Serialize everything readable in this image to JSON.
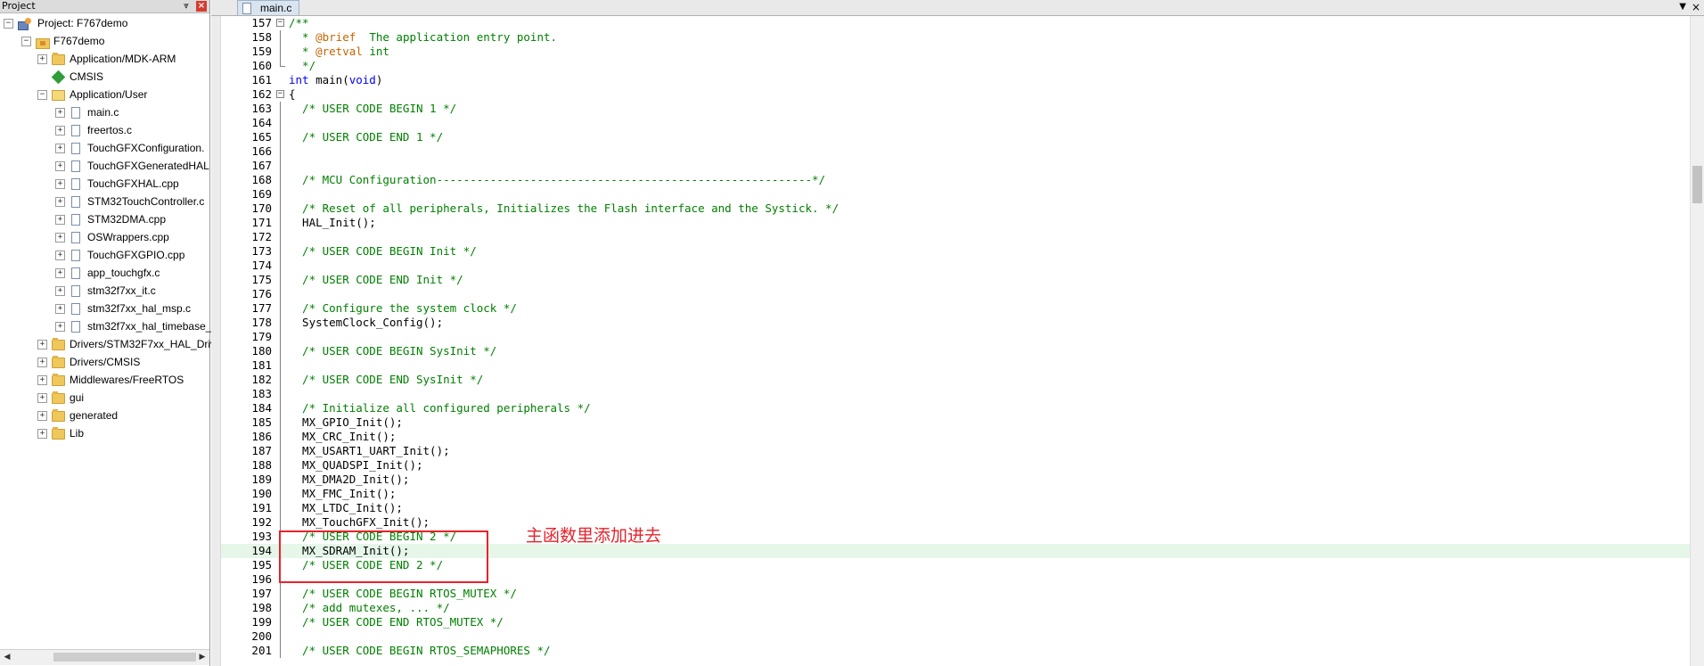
{
  "project_panel": {
    "title": "Project",
    "pin_glyph": "⩔",
    "close_glyph": "×",
    "tree": [
      {
        "label": "Project: F767demo",
        "icon": "project-icon",
        "expander": "−"
      },
      {
        "label": "F767demo",
        "icon": "target-icon",
        "expander": "−"
      },
      {
        "label": "Application/MDK-ARM",
        "icon": "folder-icon",
        "expander": "+"
      },
      {
        "label": "CMSIS",
        "icon": "diamond-icon",
        "expander": ""
      },
      {
        "label": "Application/User",
        "icon": "folder-open-icon",
        "expander": "−"
      },
      {
        "label": "main.c",
        "icon": "file-icon",
        "expander": "+"
      },
      {
        "label": "freertos.c",
        "icon": "file-icon",
        "expander": "+"
      },
      {
        "label": "TouchGFXConfiguration.",
        "icon": "file-icon",
        "expander": "+"
      },
      {
        "label": "TouchGFXGeneratedHAL",
        "icon": "file-icon",
        "expander": "+"
      },
      {
        "label": "TouchGFXHAL.cpp",
        "icon": "file-icon",
        "expander": "+"
      },
      {
        "label": "STM32TouchController.c",
        "icon": "file-icon",
        "expander": "+"
      },
      {
        "label": "STM32DMA.cpp",
        "icon": "file-icon",
        "expander": "+"
      },
      {
        "label": "OSWrappers.cpp",
        "icon": "file-icon",
        "expander": "+"
      },
      {
        "label": "TouchGFXGPIO.cpp",
        "icon": "file-icon",
        "expander": "+"
      },
      {
        "label": "app_touchgfx.c",
        "icon": "file-icon",
        "expander": "+"
      },
      {
        "label": "stm32f7xx_it.c",
        "icon": "file-icon",
        "expander": "+"
      },
      {
        "label": "stm32f7xx_hal_msp.c",
        "icon": "file-icon",
        "expander": "+"
      },
      {
        "label": "stm32f7xx_hal_timebase_",
        "icon": "file-icon",
        "expander": "+"
      },
      {
        "label": "Drivers/STM32F7xx_HAL_Driv",
        "icon": "folder-icon",
        "expander": "+"
      },
      {
        "label": "Drivers/CMSIS",
        "icon": "folder-icon",
        "expander": "+"
      },
      {
        "label": "Middlewares/FreeRTOS",
        "icon": "folder-icon",
        "expander": "+"
      },
      {
        "label": "gui",
        "icon": "folder-icon",
        "expander": "+"
      },
      {
        "label": "generated",
        "icon": "folder-icon",
        "expander": "+"
      },
      {
        "label": "Lib",
        "icon": "folder-icon",
        "expander": "+"
      }
    ],
    "scroll_left_glyph": "◀",
    "scroll_right_glyph": "▶"
  },
  "editor": {
    "tab_label": "main.c",
    "tab_dropdown_glyph": "▼",
    "tab_close_glyph": "×",
    "current_line": 194,
    "colors": {
      "comment": "#008000",
      "keyword": "#0000ff",
      "doc_tag": "#c86400",
      "current_line_bg": "#e6f7e9"
    },
    "lines": [
      {
        "n": "157",
        "text": "/**",
        "kind": "comment",
        "fold": "box"
      },
      {
        "n": "158",
        "text": "  * @brief  The application entry point.",
        "kind": "doc",
        "fold": "line"
      },
      {
        "n": "159",
        "text": "  * @retval int",
        "kind": "doc",
        "fold": "line"
      },
      {
        "n": "160",
        "text": "  */",
        "kind": "comment",
        "fold": "end"
      },
      {
        "n": "161",
        "text": "int main(void)",
        "kind": "signature",
        "fold": ""
      },
      {
        "n": "162",
        "text": "{",
        "kind": "plain",
        "fold": "box"
      },
      {
        "n": "163",
        "text": "  /* USER CODE BEGIN 1 */",
        "kind": "comment",
        "fold": "line"
      },
      {
        "n": "164",
        "text": "",
        "kind": "plain",
        "fold": "line"
      },
      {
        "n": "165",
        "text": "  /* USER CODE END 1 */",
        "kind": "comment",
        "fold": "line"
      },
      {
        "n": "166",
        "text": "",
        "kind": "plain",
        "fold": "line"
      },
      {
        "n": "167",
        "text": "",
        "kind": "plain",
        "fold": "line"
      },
      {
        "n": "168",
        "text": "  /* MCU Configuration--------------------------------------------------------*/",
        "kind": "comment",
        "fold": "line"
      },
      {
        "n": "169",
        "text": "",
        "kind": "plain",
        "fold": "line"
      },
      {
        "n": "170",
        "text": "  /* Reset of all peripherals, Initializes the Flash interface and the Systick. */",
        "kind": "comment",
        "fold": "line"
      },
      {
        "n": "171",
        "text": "  HAL_Init();",
        "kind": "plain",
        "fold": "line"
      },
      {
        "n": "172",
        "text": "",
        "kind": "plain",
        "fold": "line"
      },
      {
        "n": "173",
        "text": "  /* USER CODE BEGIN Init */",
        "kind": "comment",
        "fold": "line"
      },
      {
        "n": "174",
        "text": "",
        "kind": "plain",
        "fold": "line"
      },
      {
        "n": "175",
        "text": "  /* USER CODE END Init */",
        "kind": "comment",
        "fold": "line"
      },
      {
        "n": "176",
        "text": "",
        "kind": "plain",
        "fold": "line"
      },
      {
        "n": "177",
        "text": "  /* Configure the system clock */",
        "kind": "comment",
        "fold": "line"
      },
      {
        "n": "178",
        "text": "  SystemClock_Config();",
        "kind": "plain",
        "fold": "line"
      },
      {
        "n": "179",
        "text": "",
        "kind": "plain",
        "fold": "line"
      },
      {
        "n": "180",
        "text": "  /* USER CODE BEGIN SysInit */",
        "kind": "comment",
        "fold": "line"
      },
      {
        "n": "181",
        "text": "",
        "kind": "plain",
        "fold": "line"
      },
      {
        "n": "182",
        "text": "  /* USER CODE END SysInit */",
        "kind": "comment",
        "fold": "line"
      },
      {
        "n": "183",
        "text": "",
        "kind": "plain",
        "fold": "line"
      },
      {
        "n": "184",
        "text": "  /* Initialize all configured peripherals */",
        "kind": "comment",
        "fold": "line"
      },
      {
        "n": "185",
        "text": "  MX_GPIO_Init();",
        "kind": "plain",
        "fold": "line"
      },
      {
        "n": "186",
        "text": "  MX_CRC_Init();",
        "kind": "plain",
        "fold": "line"
      },
      {
        "n": "187",
        "text": "  MX_USART1_UART_Init();",
        "kind": "plain",
        "fold": "line"
      },
      {
        "n": "188",
        "text": "  MX_QUADSPI_Init();",
        "kind": "plain",
        "fold": "line"
      },
      {
        "n": "189",
        "text": "  MX_DMA2D_Init();",
        "kind": "plain",
        "fold": "line"
      },
      {
        "n": "190",
        "text": "  MX_FMC_Init();",
        "kind": "plain",
        "fold": "line"
      },
      {
        "n": "191",
        "text": "  MX_LTDC_Init();",
        "kind": "plain",
        "fold": "line"
      },
      {
        "n": "192",
        "text": "  MX_TouchGFX_Init();",
        "kind": "plain",
        "fold": "line"
      },
      {
        "n": "193",
        "text": "  /* USER CODE BEGIN 2 */",
        "kind": "comment",
        "fold": "line"
      },
      {
        "n": "194",
        "text": "  MX_SDRAM_Init();",
        "kind": "plain",
        "fold": "line"
      },
      {
        "n": "195",
        "text": "  /* USER CODE END 2 */",
        "kind": "comment",
        "fold": "line"
      },
      {
        "n": "196",
        "text": "",
        "kind": "plain",
        "fold": "line"
      },
      {
        "n": "197",
        "text": "  /* USER CODE BEGIN RTOS_MUTEX */",
        "kind": "comment",
        "fold": "line"
      },
      {
        "n": "198",
        "text": "  /* add mutexes, ... */",
        "kind": "comment",
        "fold": "line"
      },
      {
        "n": "199",
        "text": "  /* USER CODE END RTOS_MUTEX */",
        "kind": "comment",
        "fold": "line"
      },
      {
        "n": "200",
        "text": "",
        "kind": "plain",
        "fold": "line"
      },
      {
        "n": "201",
        "text": "  /* USER CODE BEGIN RTOS_SEMAPHORES */",
        "kind": "comment",
        "fold": "line"
      }
    ]
  },
  "annotation": {
    "text": "主函数里添加进去",
    "color": "#e8222a"
  }
}
